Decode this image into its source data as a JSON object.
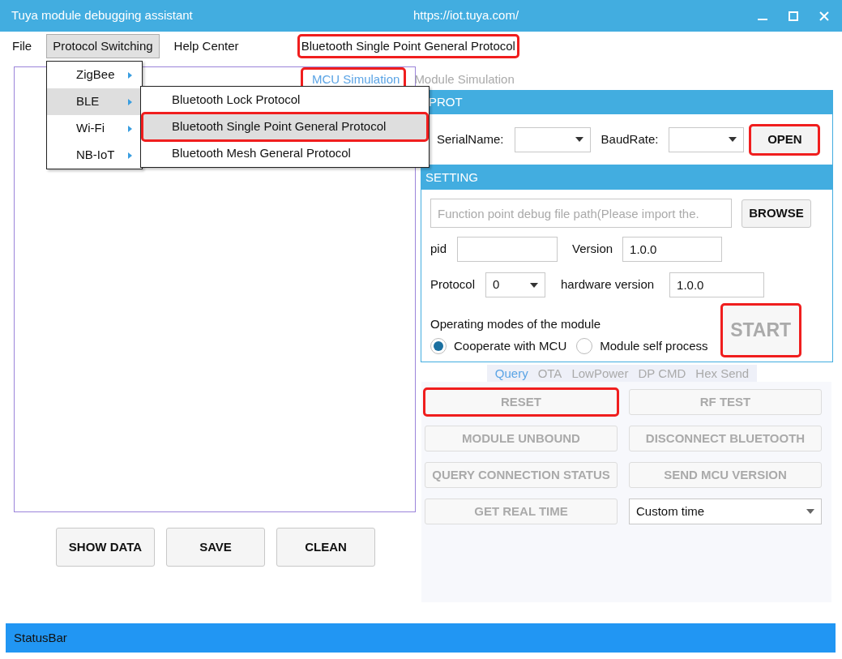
{
  "window": {
    "title": "Tuya module debugging assistant",
    "url": "https://iot.tuya.com/"
  },
  "menu_bar": [
    {
      "label": "File",
      "selected": false
    },
    {
      "label": "Protocol Switching",
      "selected": true
    },
    {
      "label": "Help Center",
      "selected": false
    }
  ],
  "current_protocol": {
    "text": "Bluetooth Single Point General Protocol",
    "highlighted": true
  },
  "protocol_menu": [
    {
      "label": "ZigBee",
      "selected": false
    },
    {
      "label": "BLE",
      "selected": true
    },
    {
      "label": "Wi-Fi",
      "selected": false
    },
    {
      "label": "NB-IoT",
      "selected": false
    }
  ],
  "ble_submenu": [
    {
      "label": "Bluetooth Lock Protocol",
      "selected": false,
      "highlighted": false
    },
    {
      "label": "Bluetooth Single Point General Protocol",
      "selected": true,
      "highlighted": true
    },
    {
      "label": "Bluetooth Mesh General Protocol",
      "selected": false,
      "highlighted": false
    }
  ],
  "mode_tabs": [
    {
      "label": "MCU Simulation",
      "selected": true,
      "highlighted": true
    },
    {
      "label": "Module Simulation",
      "selected": false,
      "highlighted": false
    }
  ],
  "prot": {
    "title": "PROT",
    "serial_label": "SerialName:",
    "baud_label": "BaudRate:",
    "open_button": {
      "label": "OPEN",
      "highlighted": true
    }
  },
  "setting": {
    "title": "SETTING",
    "file_path": {
      "placeholder": "Function point debug file path(Please import the."
    },
    "browse_button": "BROWSE",
    "pid_label": "pid",
    "version_label": "Version",
    "version": "1.0.0",
    "protocol_label": "Protocol",
    "protocol": "0",
    "hardware_label": "hardware version",
    "hardware_version": "1.0.0",
    "modes_label": "Operating modes of the module",
    "modes": [
      {
        "label": "Cooperate with MCU",
        "selected": true
      },
      {
        "label": "Module self process",
        "selected": false
      }
    ],
    "start_button": {
      "label": "START",
      "disabled": true,
      "highlighted": true
    }
  },
  "sub_tabs": [
    {
      "label": "Query",
      "selected": true
    },
    {
      "label": "OTA",
      "selected": false
    },
    {
      "label": "LowPower",
      "selected": false
    },
    {
      "label": "DP CMD",
      "selected": false
    },
    {
      "label": "Hex Send",
      "selected": false
    }
  ],
  "query_buttons": [
    {
      "label": "RESET",
      "disabled": true,
      "highlighted": true
    },
    {
      "label": "RF TEST",
      "disabled": true,
      "highlighted": false
    },
    {
      "label": "MODULE UNBOUND",
      "disabled": true,
      "highlighted": false
    },
    {
      "label": "DISCONNECT BLUETOOTH",
      "disabled": true,
      "highlighted": false
    },
    {
      "label": "QUERY CONNECTION STATUS",
      "disabled": true,
      "highlighted": false
    },
    {
      "label": "SEND MCU VERSION",
      "disabled": true,
      "highlighted": false
    },
    {
      "label": "GET REAL TIME",
      "disabled": true,
      "highlighted": false
    }
  ],
  "time_select": {
    "value": "Custom time"
  },
  "log_buttons": [
    "SHOW DATA",
    "SAVE",
    "CLEAN"
  ],
  "status_bar": "StatusBar"
}
